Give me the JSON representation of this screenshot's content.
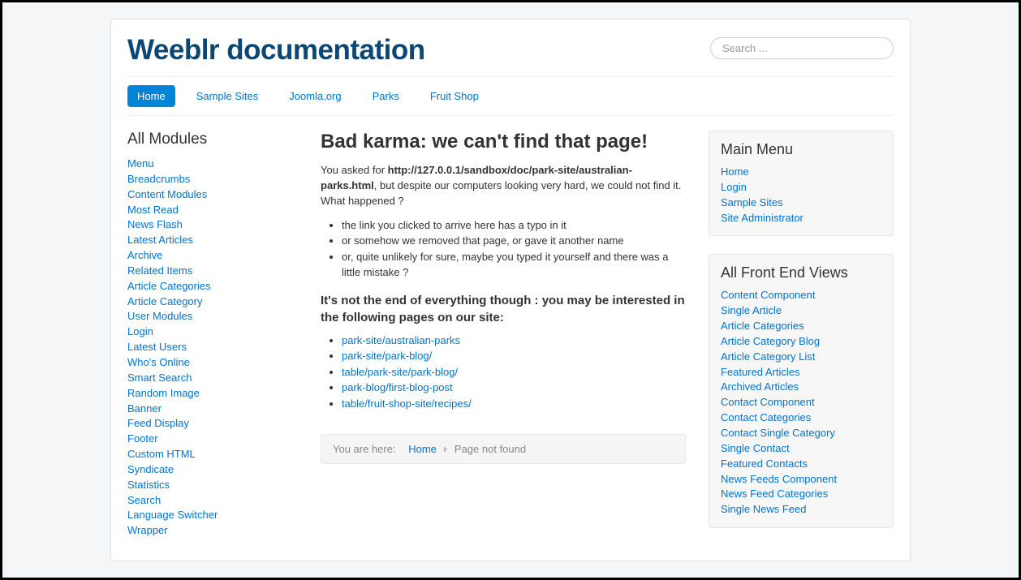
{
  "site_title": "Weeblr documentation",
  "search": {
    "placeholder": "Search ..."
  },
  "nav": [
    {
      "label": "Home",
      "active": true
    },
    {
      "label": "Sample Sites",
      "active": false
    },
    {
      "label": "Joomla.org",
      "active": false
    },
    {
      "label": "Parks",
      "active": false
    },
    {
      "label": "Fruit Shop",
      "active": false
    }
  ],
  "left": {
    "heading": "All Modules",
    "items": [
      "Menu",
      "Breadcrumbs",
      "Content Modules",
      "Most Read",
      "News Flash",
      "Latest Articles",
      "Archive",
      "Related Items",
      "Article Categories",
      "Article Category",
      "User Modules",
      "Login",
      "Latest Users",
      "Who's Online",
      "Smart Search",
      "Random Image",
      "Banner",
      "Feed Display",
      "Footer",
      "Custom HTML",
      "Syndicate",
      "Statistics",
      "Search",
      "Language Switcher",
      "Wrapper"
    ]
  },
  "content": {
    "title": "Bad karma: we can't find that page!",
    "asked_prefix": "You asked for ",
    "asked_url": "http://127.0.0.1/sandbox/doc/park-site/australian-parks.html",
    "asked_suffix": ", but despite our computers looking very hard, we could not find it. What happened ?",
    "reasons": [
      "the link you clicked to arrive here has a typo in it",
      "or somehow we removed that page, or gave it another name",
      "or, quite unlikely for sure, maybe you typed it yourself and there was a little mistake ?"
    ],
    "alt_heading": "It's not the end of everything though : you may be interested in the following pages on our site:",
    "alt_links": [
      "park-site/australian-parks",
      "park-site/park-blog/",
      "table/park-site/park-blog/",
      "park-blog/first-blog-post",
      "table/fruit-shop-site/recipes/"
    ]
  },
  "breadcrumb": {
    "prefix": "You are here:",
    "home": "Home",
    "current": "Page not found"
  },
  "right": {
    "menu_heading": "Main Menu",
    "menu_items": [
      "Home",
      "Login",
      "Sample Sites",
      "Site Administrator"
    ],
    "views_heading": "All Front End Views",
    "views_items": [
      "Content Component",
      "Single Article",
      "Article Categories",
      "Article Category Blog",
      "Article Category List",
      "Featured Articles",
      "Archived Articles",
      "Contact Component",
      "Contact Categories",
      "Contact Single Category",
      "Single Contact",
      "Featured Contacts",
      "News Feeds Component",
      "News Feed Categories",
      "Single News Feed"
    ]
  }
}
